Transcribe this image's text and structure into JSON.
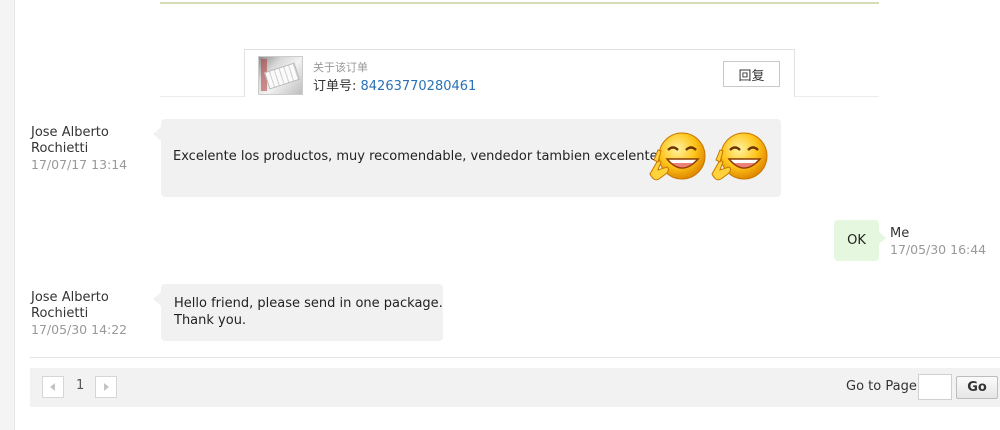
{
  "order": {
    "title": "关于该订单",
    "number_label": "订单号: ",
    "number": "84263770280461",
    "reply_label": "回复"
  },
  "messages": [
    {
      "sender_line1": "Jose Alberto",
      "sender_line2": "Rochietti",
      "time": "17/07/17 13:14",
      "text": "Excelente los productos, muy recomendable, vendedor tambien excelente.",
      "emoji_icons": [
        "laughing-thumbs-up-emoji-icon",
        "laughing-thumbs-up-emoji-icon"
      ]
    },
    {
      "sender_line1": "Me",
      "time": "17/05/30 16:44",
      "text": "OK"
    },
    {
      "sender_line1": "Jose Alberto",
      "sender_line2": "Rochietti",
      "time": "17/05/30 14:22",
      "text_line1": "Hello friend, please send in one package.",
      "text_line2": "Thank you."
    }
  ],
  "pagination": {
    "current_page": "1",
    "goto_label": "Go to Page",
    "goto_value": "",
    "go_label": "Go"
  }
}
